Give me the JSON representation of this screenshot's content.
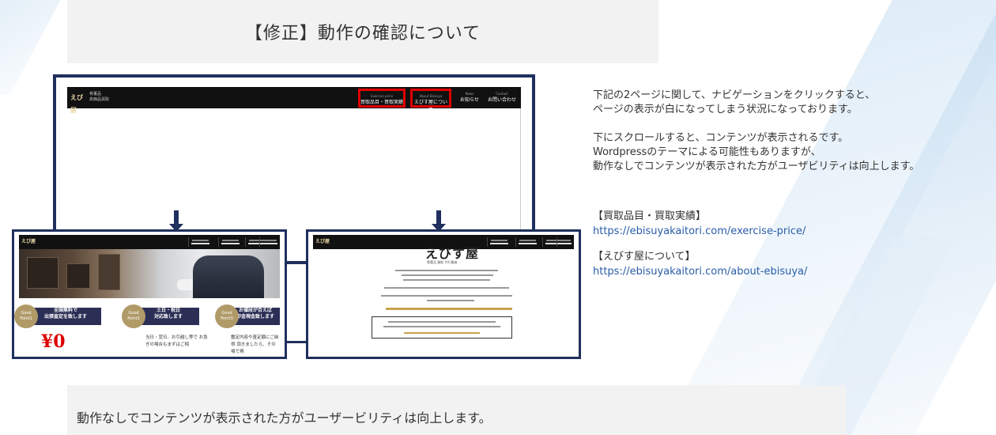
{
  "slide": {
    "title": "【修正】動作の確認について",
    "bottom_note": "動作なしでコンテンツが表示された方がユーザービリティは向上します。"
  },
  "description": {
    "line1": "下記の2ページに関して、ナビゲーションをクリックすると、",
    "line2": "ページの表示が白になってしまう状況になっております。",
    "line3": "下にスクロールすると、コンテンツが表示されるです。",
    "line4": "Wordpressのテーマによる可能性もありますが、",
    "line5": "動作なしでコンテンツが表示された方がユーザビリティは向上します。"
  },
  "links": [
    {
      "label": "【買取品目・買取実績】",
      "url": "https://ebisuyakaitori.com/exercise-price/"
    },
    {
      "label": "【えびす屋について】",
      "url": "https://ebisuyakaitori.com/about-ebisuya/"
    }
  ],
  "screenshot_top": {
    "logo": "えび屋",
    "subtitle_line1": "骨董品",
    "subtitle_line2": "高価品買取",
    "nav": [
      {
        "en": "Exercise price",
        "jp": "買取品目・買取実績",
        "highlighted": true
      },
      {
        "en": "About Ebisuya",
        "jp": "えびす屋について",
        "highlighted": true
      },
      {
        "en": "News",
        "jp": "お知らせ",
        "highlighted": false
      },
      {
        "en": "Contact",
        "jp": "お問い合わせ",
        "highlighted": false
      }
    ]
  },
  "screenshot_left": {
    "points": [
      {
        "badge": "Good Point1",
        "title_line1": "全国無料で",
        "title_line2": "出張査定を致します"
      },
      {
        "badge": "Good Point2",
        "title_line1": "土日・祝日",
        "title_line2": "対応致します"
      },
      {
        "badge": "Good Point3",
        "title_line1": "お値段が合えば",
        "title_line2": "即金現金致します"
      }
    ],
    "yen_text": "¥0",
    "point2_text": "当日・翌日、お引越し等で お急ぎの場合もまずはご相",
    "point3_text": "鑑定内容や査定額にご納得 頂きましたら、その場で現"
  },
  "screenshot_right": {
    "logo": "えびす屋",
    "sub": "骨董品 買取 代行業者"
  },
  "colors": {
    "frame": "#1f2f5e",
    "highlight": "#e00000",
    "link": "#2a5da8"
  }
}
